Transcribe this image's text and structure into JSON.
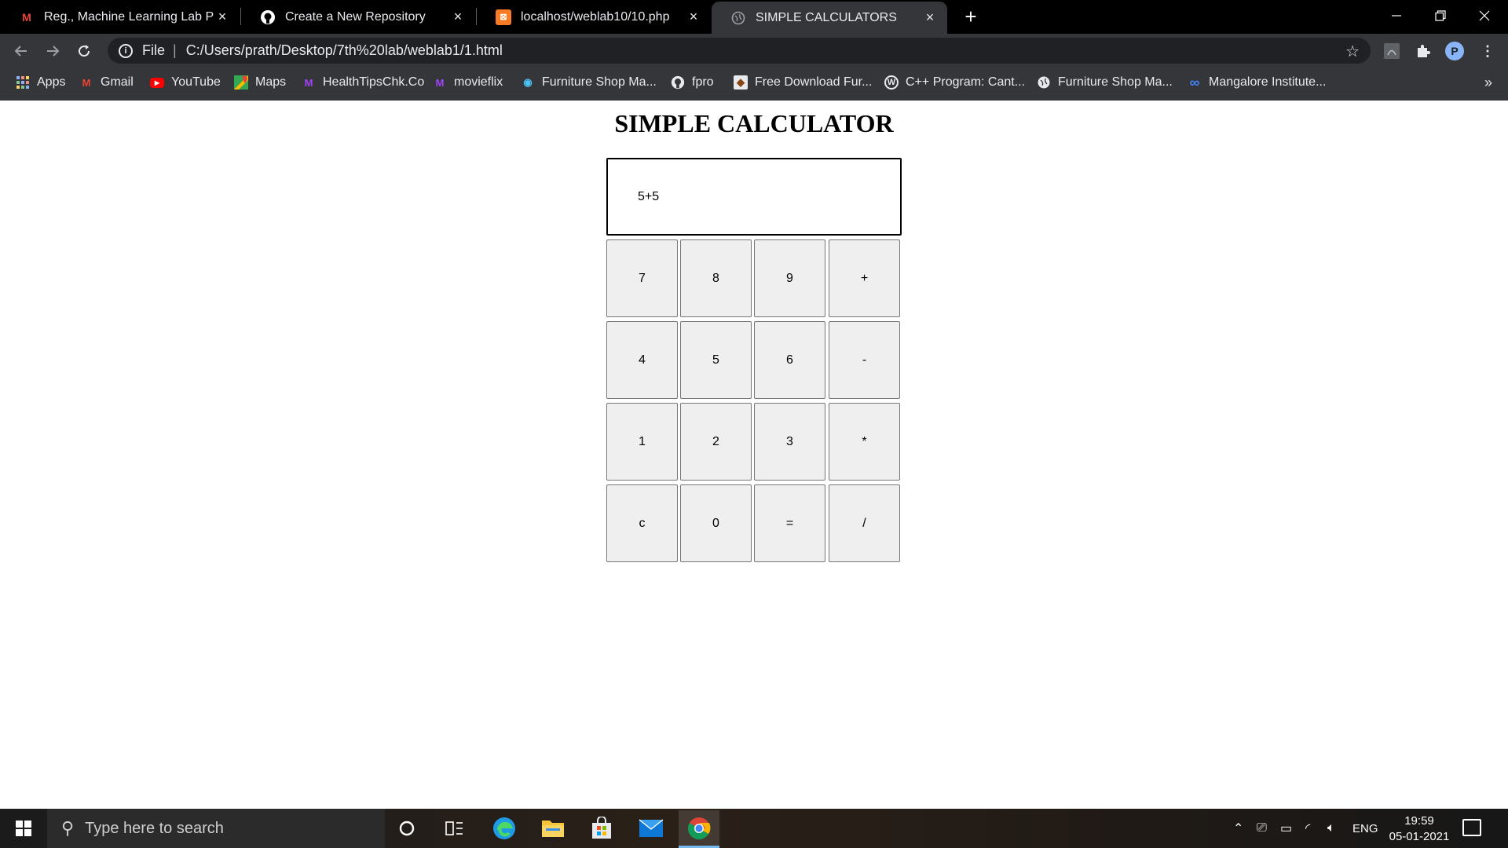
{
  "browser": {
    "tabs": [
      {
        "title": "Reg., Machine Learning Lab Prog",
        "icon": "gmail-icon"
      },
      {
        "title": "Create a New Repository",
        "icon": "github-icon"
      },
      {
        "title": "localhost/weblab10/10.php",
        "icon": "xampp-icon"
      },
      {
        "title": "SIMPLE CALCULATORS",
        "icon": "globe-icon",
        "active": true
      }
    ],
    "address": {
      "scheme": "File",
      "url": "C:/Users/prath/Desktop/7th%20lab/weblab1/1.html"
    },
    "profile_initial": "P",
    "bookmarks": [
      {
        "label": "Apps",
        "icon": "apps-grid-icon"
      },
      {
        "label": "Gmail",
        "icon": "gmail-icon"
      },
      {
        "label": "YouTube",
        "icon": "youtube-icon"
      },
      {
        "label": "Maps",
        "icon": "maps-icon"
      },
      {
        "label": "HealthTipsChk.Co",
        "icon": "site-m-icon"
      },
      {
        "label": "movieflix",
        "icon": "site-m-icon"
      },
      {
        "label": "Furniture Shop Ma...",
        "icon": "site-icon"
      },
      {
        "label": "fpro",
        "icon": "github-icon"
      },
      {
        "label": "Free Download Fur...",
        "icon": "site-icon"
      },
      {
        "label": "C++ Program: Cant...",
        "icon": "wordpress-icon"
      },
      {
        "label": "Furniture Shop Ma...",
        "icon": "globe-icon"
      },
      {
        "label": "Mangalore Institute...",
        "icon": "infinity-icon"
      }
    ]
  },
  "calculator": {
    "title": "SIMPLE CALCULATOR",
    "display_value": "5+5",
    "keys": [
      [
        "7",
        "8",
        "9",
        "+"
      ],
      [
        "4",
        "5",
        "6",
        "-"
      ],
      [
        "1",
        "2",
        "3",
        "*"
      ],
      [
        "c",
        "0",
        "=",
        "/"
      ]
    ]
  },
  "taskbar": {
    "search_placeholder": "Type here to search",
    "language": "ENG",
    "time": "19:59",
    "date": "05-01-2021"
  }
}
